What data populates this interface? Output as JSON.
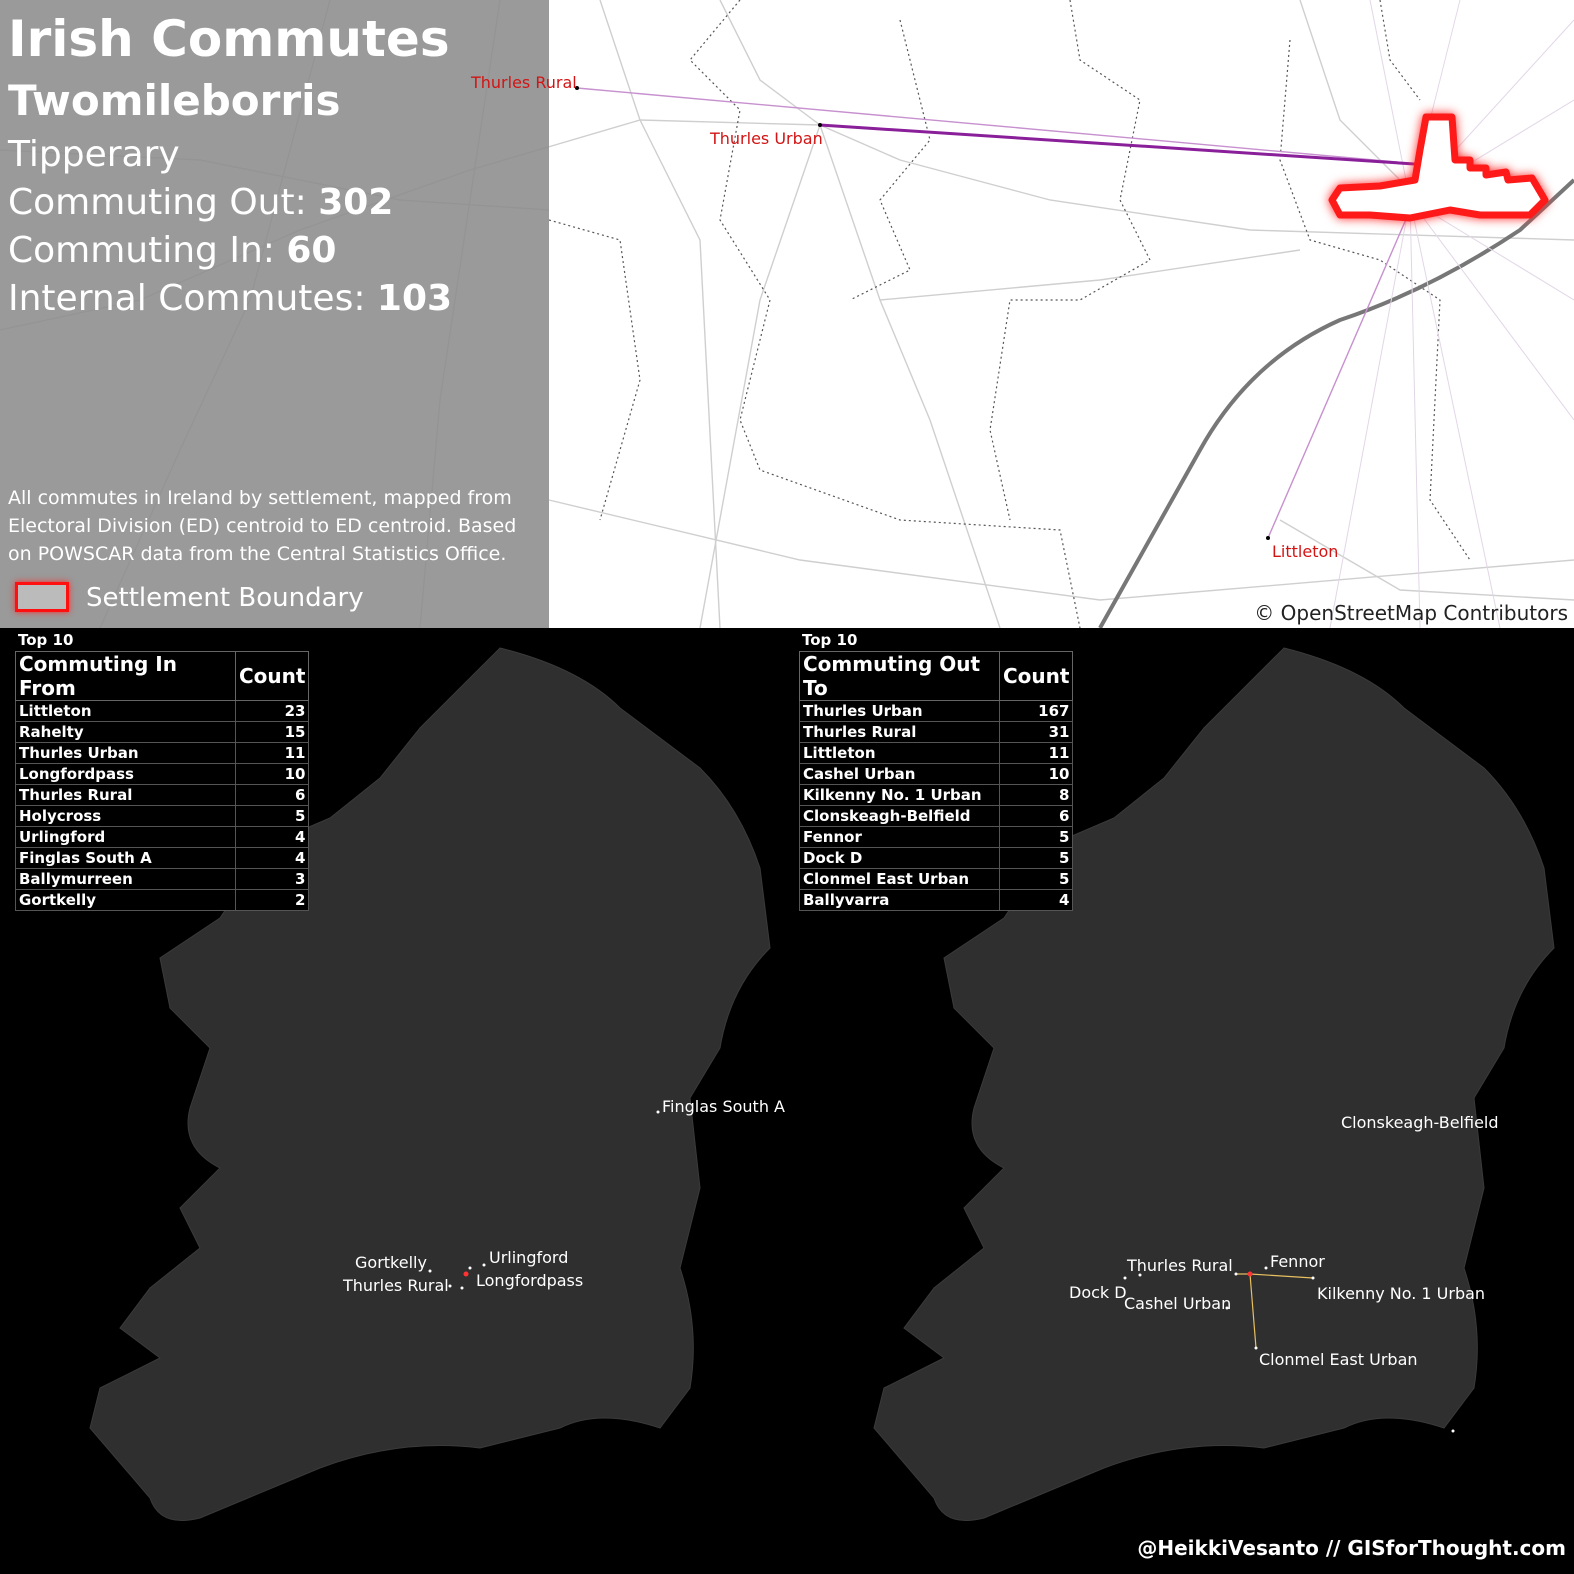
{
  "header": {
    "title": "Irish Commutes",
    "settlement": "Twomileborris",
    "county": "Tipperary",
    "commuting_out_label": "Commuting Out: ",
    "commuting_out": "302",
    "commuting_in_label": "Commuting In: ",
    "commuting_in": "60",
    "internal_label": "Internal Commutes: ",
    "internal": "103"
  },
  "description": "All commutes in Ireland by settlement, mapped from Electoral Division (ED) centroid to ED centroid. Based on POWSCAR data from the Central Statistics Office.",
  "legend": {
    "label": "Settlement Boundary",
    "color": "#ff1010"
  },
  "top_map": {
    "places": [
      "Thurles Rural",
      "Thurles Urban",
      "Littleton"
    ],
    "attribution": "© OpenStreetMap Contributors",
    "commute_line_color": "#8a1f9a"
  },
  "in_table": {
    "caption": "Top 10",
    "col1": "Commuting In From",
    "col2": "Count",
    "rows": [
      {
        "name": "Littleton",
        "count": "23"
      },
      {
        "name": "Rahelty",
        "count": "15"
      },
      {
        "name": "Thurles Urban",
        "count": "11"
      },
      {
        "name": "Longfordpass",
        "count": "10"
      },
      {
        "name": "Thurles Rural",
        "count": "6"
      },
      {
        "name": "Holycross",
        "count": "5"
      },
      {
        "name": "Urlingford",
        "count": "4"
      },
      {
        "name": "Finglas South A",
        "count": "4"
      },
      {
        "name": "Ballymurreen",
        "count": "3"
      },
      {
        "name": "Gortkelly",
        "count": "2"
      }
    ]
  },
  "out_table": {
    "caption": "Top 10",
    "col1": "Commuting Out To",
    "col2": "Count",
    "rows": [
      {
        "name": "Thurles Urban",
        "count": "167"
      },
      {
        "name": "Thurles Rural",
        "count": "31"
      },
      {
        "name": "Littleton",
        "count": "11"
      },
      {
        "name": "Cashel Urban",
        "count": "10"
      },
      {
        "name": "Kilkenny No. 1 Urban",
        "count": "8"
      },
      {
        "name": "Clonskeagh-Belfield",
        "count": "6"
      },
      {
        "name": "Fennor",
        "count": "5"
      },
      {
        "name": "Dock D",
        "count": "5"
      },
      {
        "name": "Clonmel East Urban",
        "count": "5"
      },
      {
        "name": "Ballyvarra",
        "count": "4"
      }
    ]
  },
  "in_map_labels": [
    "Finglas South A",
    "Gortkelly",
    "Urlingford",
    "Thurles Rural",
    "Longfordpass"
  ],
  "out_map_labels": [
    "Clonskeagh-Belfield",
    "Thurles Rural",
    "Fennor",
    "Dock D",
    "Cashel Urban",
    "Kilkenny No. 1 Urban",
    "Clonmel East Urban"
  ],
  "credit": "@HeikkiVesanto // GISforThought.com"
}
